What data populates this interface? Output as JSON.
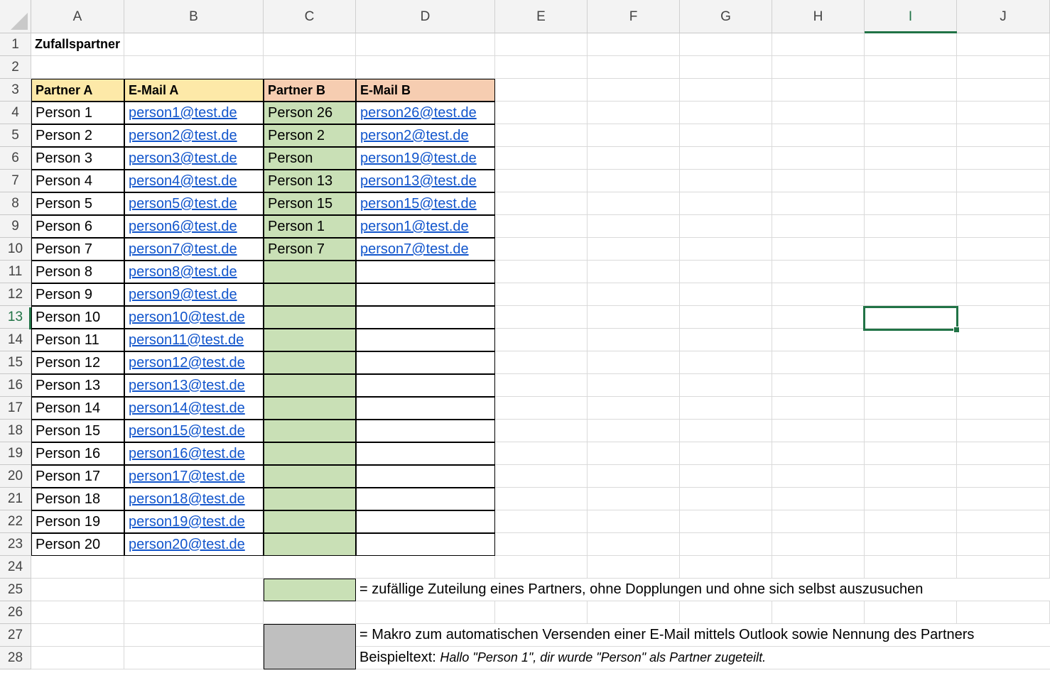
{
  "columns": [
    "A",
    "B",
    "C",
    "D",
    "E",
    "F",
    "G",
    "H",
    "I",
    "J"
  ],
  "row_numbers": [
    "1",
    "2",
    "3",
    "4",
    "5",
    "6",
    "7",
    "8",
    "9",
    "10",
    "11",
    "12",
    "13",
    "14",
    "15",
    "16",
    "17",
    "18",
    "19",
    "20",
    "21",
    "22",
    "23",
    "24",
    "25",
    "26",
    "27",
    "28"
  ],
  "active_cell": {
    "column": "I",
    "row": "13"
  },
  "title": "Zufallspartner",
  "headers": {
    "partner_a": "Partner A",
    "email_a": "E-Mail A",
    "partner_b": "Partner B",
    "email_b": "E-Mail B"
  },
  "partners_a": [
    {
      "name": "Person 1",
      "email": "person1@test.de"
    },
    {
      "name": "Person 2",
      "email": "person2@test.de"
    },
    {
      "name": "Person 3",
      "email": "person3@test.de"
    },
    {
      "name": "Person 4",
      "email": "person4@test.de"
    },
    {
      "name": "Person 5",
      "email": "person5@test.de"
    },
    {
      "name": "Person 6",
      "email": "person6@test.de"
    },
    {
      "name": "Person 7",
      "email": "person7@test.de"
    },
    {
      "name": "Person 8",
      "email": "person8@test.de"
    },
    {
      "name": "Person 9",
      "email": "person9@test.de"
    },
    {
      "name": "Person 10",
      "email": "person10@test.de"
    },
    {
      "name": "Person 11",
      "email": "person11@test.de"
    },
    {
      "name": "Person 12",
      "email": "person12@test.de"
    },
    {
      "name": "Person 13",
      "email": "person13@test.de"
    },
    {
      "name": "Person 14",
      "email": "person14@test.de"
    },
    {
      "name": "Person 15",
      "email": "person15@test.de"
    },
    {
      "name": "Person 16",
      "email": "person16@test.de"
    },
    {
      "name": "Person 17",
      "email": "person17@test.de"
    },
    {
      "name": "Person 18",
      "email": "person18@test.de"
    },
    {
      "name": "Person 19",
      "email": "person19@test.de"
    },
    {
      "name": "Person 20",
      "email": "person20@test.de"
    }
  ],
  "partners_b": [
    {
      "name": "Person 26",
      "email": "person26@test.de"
    },
    {
      "name": "Person 2",
      "email": "person2@test.de"
    },
    {
      "name": "Person",
      "email": "person19@test.de"
    },
    {
      "name": "Person 13",
      "email": "person13@test.de"
    },
    {
      "name": "Person 15",
      "email": "person15@test.de"
    },
    {
      "name": "Person 1",
      "email": "person1@test.de"
    },
    {
      "name": "Person 7",
      "email": "person7@test.de"
    }
  ],
  "legend": {
    "green_text": "= zufällige Zuteilung eines Partners, ohne Dopplungen und ohne sich selbst auszusuchen",
    "gray_text": "= Makro zum automatischen Versenden einer E-Mail mittels Outlook sowie Nennung des Partners",
    "example_label": "Beispieltext:",
    "example_text": "Hallo \"Person 1\", dir wurde \"Person\" als Partner zugeteilt."
  },
  "colors": {
    "header_a_fill": "#fde9a8",
    "header_b_fill": "#f6cdb1",
    "random_fill": "#c9e0b6",
    "macro_fill": "#bfbfbf",
    "link": "#1155cc",
    "selection": "#217346"
  }
}
